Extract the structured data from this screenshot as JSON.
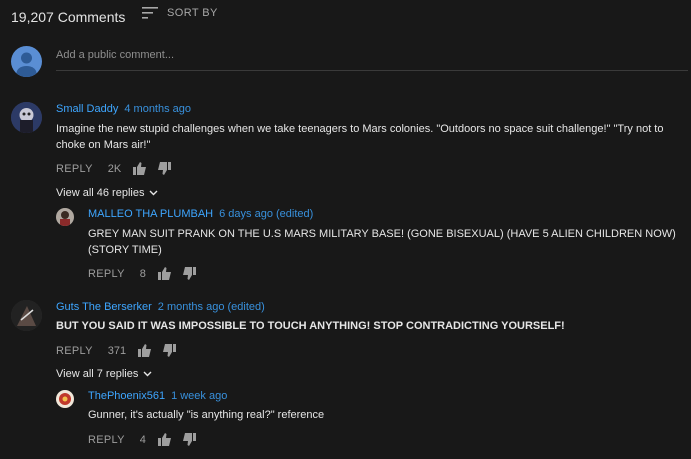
{
  "header": {
    "comment_count": "19,207 Comments",
    "sort_label": "SORT BY"
  },
  "add_comment": {
    "placeholder": "Add a public comment..."
  },
  "comments": [
    {
      "author": "Small Daddy",
      "time": "4 months ago",
      "text": "Imagine the new stupid challenges when we take teenagers to Mars colonies. \"Outdoors no space suit challenge!\" \"Try not to choke on Mars air!\"",
      "reply_label": "REPLY",
      "likes": "2K",
      "view_replies": "View all 46 replies",
      "reply": {
        "author": "MALLEO THA PLUMBAH",
        "time": "6 days ago (edited)",
        "text": "GREY MAN SUIT PRANK ON THE U.S MARS MILITARY BASE! (GONE BISEXUAL) (HAVE 5 ALIEN CHILDREN NOW) (STORY TIME)",
        "reply_label": "REPLY",
        "likes": "8"
      }
    },
    {
      "author": "Guts The Berserker",
      "time": "2 months ago (edited)",
      "text": "BUT YOU SAID IT WAS IMPOSSIBLE TO TOUCH ANYTHING! STOP CONTRADICTING YOURSELF!",
      "reply_label": "REPLY",
      "likes": "371",
      "view_replies": "View all 7 replies",
      "reply": {
        "author": "ThePhoenix561",
        "time": "1 week ago",
        "text": "Gunner, it's actually \"is anything real?\" reference",
        "reply_label": "REPLY",
        "likes": "4"
      }
    }
  ],
  "colors": {
    "background": "#181818",
    "link": "#3ea6ff",
    "muted": "#9e9e9e"
  }
}
